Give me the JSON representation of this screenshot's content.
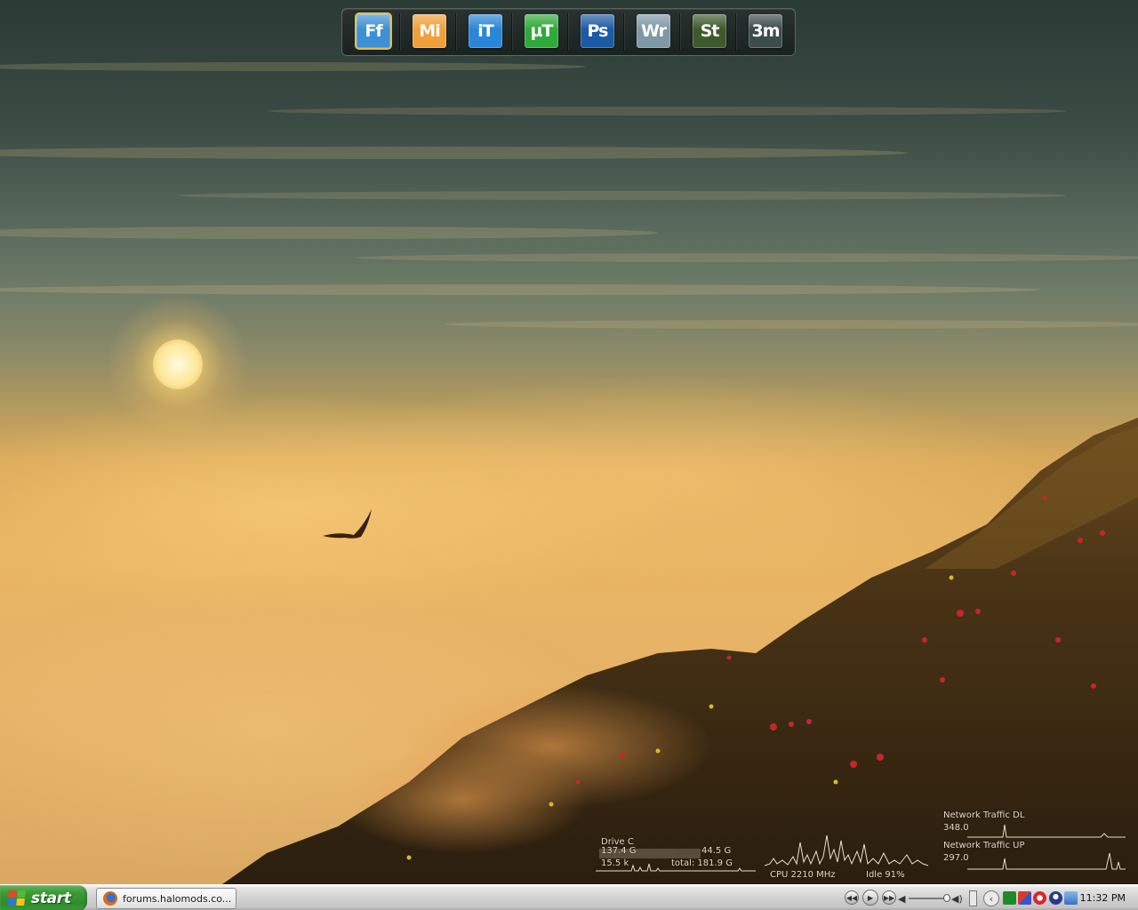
{
  "dock": {
    "items": [
      {
        "name": "firefox",
        "label": "Ff",
        "bg": "#3d8fd6",
        "selected": true
      },
      {
        "name": "miranda",
        "label": "Mi",
        "bg": "#f0a03a"
      },
      {
        "name": "itunes",
        "label": "iT",
        "bg": "#2a86d8"
      },
      {
        "name": "utorrent",
        "label": "µT",
        "bg": "#2faa3a"
      },
      {
        "name": "photoshop",
        "label": "Ps",
        "bg": "#1d5aa6"
      },
      {
        "name": "winrar",
        "label": "Wr",
        "bg": "#7e98a6"
      },
      {
        "name": "steam",
        "label": "St",
        "bg": "#3e5a2c"
      },
      {
        "name": "3dsmax",
        "label": "3m",
        "bg": "#3b4c4a"
      }
    ]
  },
  "drive": {
    "title": "Drive C",
    "used": "137.4 G",
    "free": "44.5 G",
    "io": "15.5 k",
    "total": "total: 181.9 G",
    "used_fraction": 0.755
  },
  "cpu": {
    "speed": "CPU 2210 MHz",
    "idle": "Idle 91%"
  },
  "network": {
    "dl_label": "Network Traffic DL",
    "dl_value": "348.0",
    "up_label": "Network Traffic UP",
    "up_value": "297.0"
  },
  "taskbar": {
    "start_label": "start",
    "task_label": "forums.halomods.co...",
    "clock": "11:32 PM"
  },
  "colors": {
    "taskbar": "#d2d2d2",
    "start_green": "#3c9a36",
    "widget_text": "#dfd8c8"
  }
}
